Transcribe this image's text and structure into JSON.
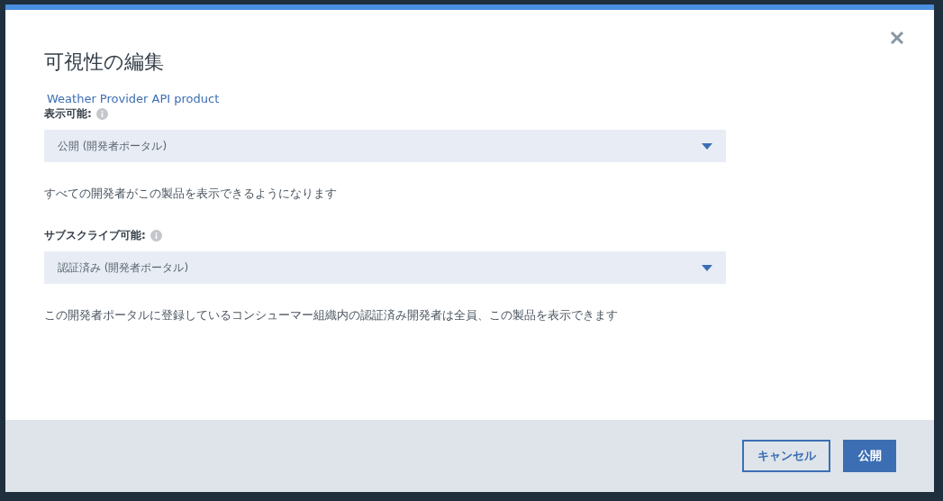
{
  "dialog": {
    "title": "可視性の編集",
    "subtitle": "Weather Provider API product",
    "fields": [
      {
        "label": "表示可能:",
        "value": "公開 (開発者ポータル)",
        "description": "すべての開発者がこの製品を表示できるようになります"
      },
      {
        "label": "サブスクライブ可能:",
        "value": "認証済み (開発者ポータル)",
        "description": "この開発者ポータルに登録しているコンシューマー組織内の認証済み開発者は全員、この製品を表示できます"
      }
    ],
    "buttons": [
      {
        "label": "キャンセル",
        "kind": "secondary"
      },
      {
        "label": "公開",
        "kind": "primary"
      }
    ]
  }
}
